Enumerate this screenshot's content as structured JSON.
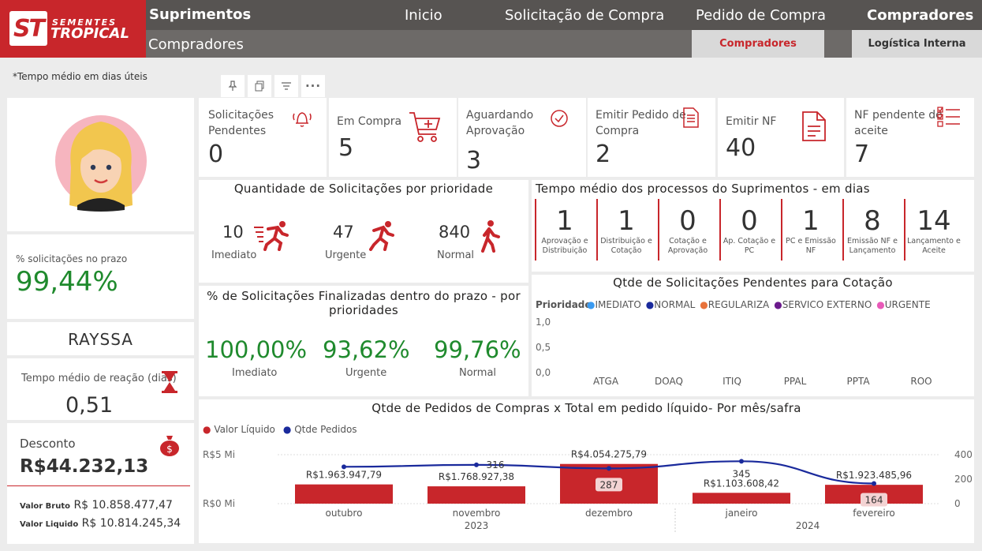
{
  "brand": {
    "logo_mark": "ST",
    "logo_line1": "SEMENTES",
    "logo_line2": "TROPICAL"
  },
  "header": {
    "section_title": "Suprimentos",
    "page_title": "Compradores",
    "nav": [
      "Inicio",
      "Solicitação de Compra",
      "Pedido de Compra",
      "Compradores"
    ],
    "subtabs": [
      "Compradores",
      "Logística Interna"
    ]
  },
  "note": "*Tempo médio em dias úteis",
  "toolbar_icons": [
    "pin-icon",
    "copy-icon",
    "filter-icon",
    "more-icon"
  ],
  "kpis": [
    {
      "label1": "Solicitações",
      "label2": "Pendentes",
      "value": "0",
      "icon": "bell-icon"
    },
    {
      "label1": "Em Compra",
      "label2": "",
      "value": "5",
      "icon": "cart-icon"
    },
    {
      "label1": "Aguardando",
      "label2": "Aprovação",
      "value": "3",
      "icon": "check-circle-icon"
    },
    {
      "label1": "Emitir Pedido de",
      "label2": "Compra",
      "value": "2",
      "icon": "document-list-icon"
    },
    {
      "label1": "Emitir NF",
      "label2": "",
      "value": "40",
      "icon": "document-icon"
    },
    {
      "label1": "NF pendente de",
      "label2": "aceite",
      "value": "7",
      "icon": "checklist-icon"
    }
  ],
  "left": {
    "prazo_label": "% solicitações no prazo",
    "prazo_value": "99,44%",
    "buyer_name": "RAYSSA",
    "reacao_label": "Tempo médio de reação (dias)",
    "reacao_value": "0,51",
    "desconto_label": "Desconto",
    "desconto_value": "R$44.232,13",
    "bruto_label": "Valor Bruto",
    "bruto_value": "R$ 10.858.477,47",
    "liquido_label": "Valor Liquido",
    "liquido_value": "R$ 10.814.245,34"
  },
  "prioridade": {
    "title": "Quantidade de Solicitações por prioridade",
    "items": [
      {
        "value": "10",
        "label": "Imediato"
      },
      {
        "value": "47",
        "label": "Urgente"
      },
      {
        "value": "840",
        "label": "Normal"
      }
    ]
  },
  "finalizadas": {
    "title1": "% de Solicitações Finalizadas dentro do prazo - por",
    "title2": "prioridades",
    "items": [
      {
        "value": "100,00%",
        "label": "Imediato"
      },
      {
        "value": "93,62%",
        "label": "Urgente"
      },
      {
        "value": "99,76%",
        "label": "Normal"
      }
    ]
  },
  "processos": {
    "title": "Tempo médio dos processos do Suprimentos - em dias",
    "items": [
      {
        "value": "1",
        "l1": "Aprovação e",
        "l2": "Distribuição"
      },
      {
        "value": "1",
        "l1": "Distribuição e",
        "l2": "Cotação"
      },
      {
        "value": "0",
        "l1": "Cotação e",
        "l2": "Aprovação"
      },
      {
        "value": "0",
        "l1": "Ap. Cotação e",
        "l2": "PC"
      },
      {
        "value": "1",
        "l1": "PC e Emissão",
        "l2": "NF"
      },
      {
        "value": "8",
        "l1": "Emissão NF e",
        "l2": "Lançamento"
      },
      {
        "value": "14",
        "l1": "Lançamento e",
        "l2": "Aceite"
      }
    ]
  },
  "colors": {
    "red": "#c8262b",
    "green": "#1f8a2d",
    "navy": "#1a2a9c",
    "bar": "#c8262b"
  },
  "chart_data": [
    {
      "type": "bar",
      "title": "Qtde de Solicitações Pendentes para Cotação",
      "legend_title": "Prioridade",
      "series": [
        {
          "name": "IMEDIATO",
          "color": "#3a9af0",
          "values": []
        },
        {
          "name": "NORMAL",
          "color": "#1a2a9c",
          "values": []
        },
        {
          "name": "REGULARIZA",
          "color": "#e8723a",
          "values": []
        },
        {
          "name": "SERVICO EXTERNO",
          "color": "#6b1a8c",
          "values": []
        },
        {
          "name": "URGENTE",
          "color": "#e85ab8",
          "values": []
        }
      ],
      "categories": [
        "ATGA",
        "DOAQ",
        "ITIQ",
        "PPAL",
        "PPTA",
        "ROO"
      ],
      "yticks": [
        "1,0",
        "0,5",
        "0,0"
      ],
      "ylim": [
        0,
        1
      ],
      "legend": "top-left"
    },
    {
      "type": "bar",
      "title": "Qtde de Pedidos de Compras x Total em pedido líquido- Por mês/safra",
      "legend": "top-left",
      "categories": [
        "outubro",
        "novembro",
        "dezembro",
        "janeiro",
        "fevereiro"
      ],
      "year_labels": [
        "2023",
        "2024"
      ],
      "series": [
        {
          "name": "Valor Líquido",
          "color": "#c8262b",
          "values": [
            1963947.79,
            1768927.38,
            4054275.79,
            1103608.42,
            1923485.96
          ],
          "labels": [
            "R$1.963.947,79",
            "R$1.768.927,38",
            "R$4.054.275,79",
            "R$1.103.608,42",
            "R$1.923.485,96"
          ]
        },
        {
          "name": "Qtde Pedidos",
          "color": "#1a2a9c",
          "values": [
            300,
            316,
            287,
            345,
            164
          ],
          "labels": [
            "",
            "316",
            "287",
            "345",
            "164"
          ]
        }
      ],
      "left_axis_ticks": [
        "R$5 Mi",
        "R$0 Mi"
      ],
      "left_ylim": [
        0,
        5000000
      ],
      "right_axis_ticks": [
        "400",
        "200",
        "0"
      ],
      "right_ylim": [
        0,
        450
      ]
    }
  ]
}
